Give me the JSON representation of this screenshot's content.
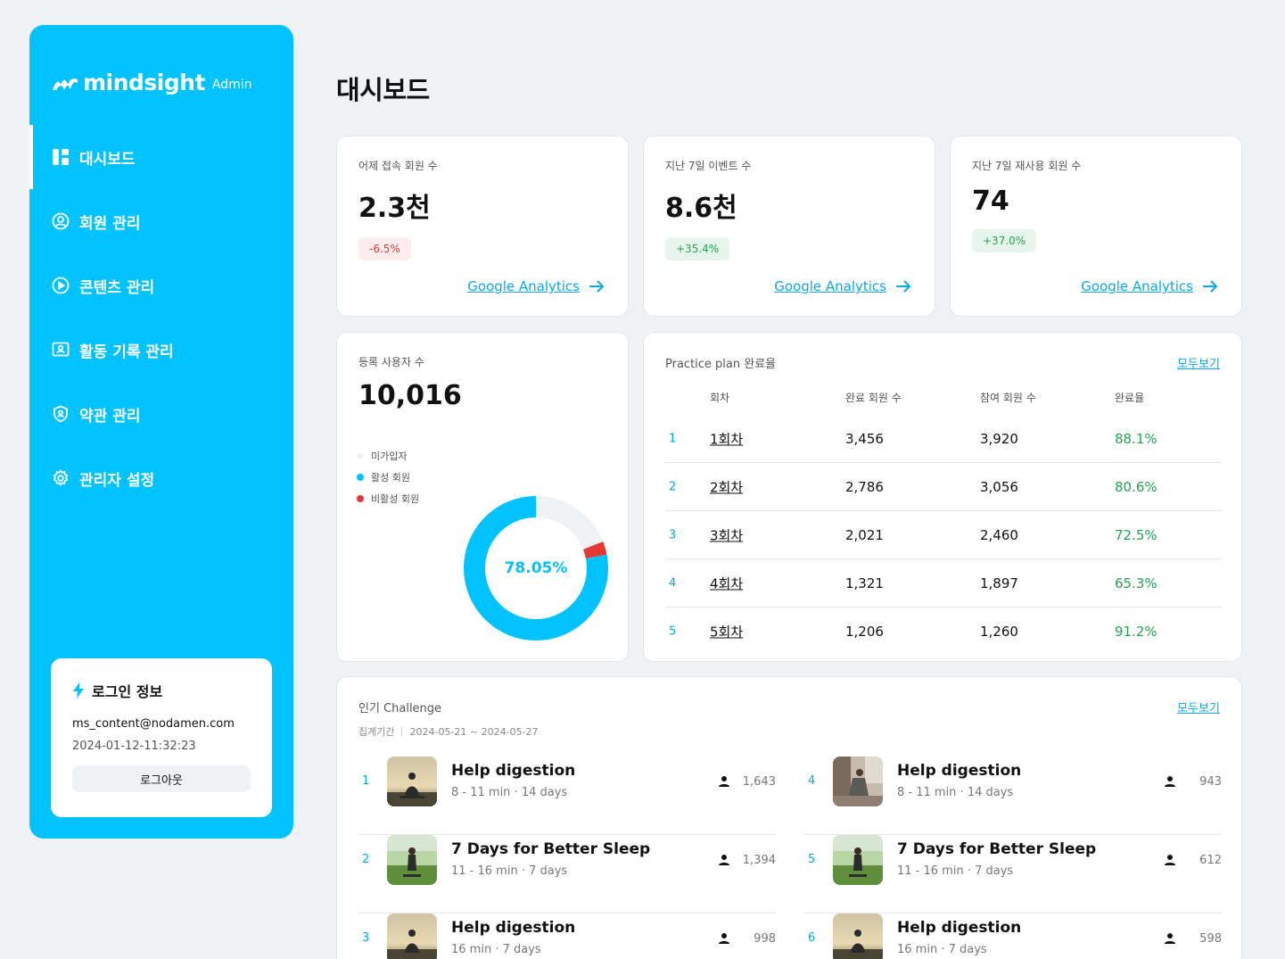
{
  "brand": {
    "name": "mindsight",
    "sub": "Admin"
  },
  "page_title": "대시보드",
  "nav": [
    {
      "label": "대시보드",
      "icon": "dashboard-icon",
      "active": true
    },
    {
      "label": "회원 관리",
      "icon": "user-circle-icon"
    },
    {
      "label": "콘텐츠 관리",
      "icon": "play-circle-icon"
    },
    {
      "label": "활동 기록 관리",
      "icon": "id-card-icon"
    },
    {
      "label": "약관 관리",
      "icon": "shield-user-icon"
    },
    {
      "label": "관리자 설정",
      "icon": "gear-icon"
    }
  ],
  "login": {
    "title": "로그인 정보",
    "email": "ms_content@nodamen.com",
    "time": "2024-01-12-11:32:23",
    "logout": "로그아웃"
  },
  "metrics": [
    {
      "label": "어제 접속 회원 수",
      "value": "2.3천",
      "change": "-6.5%",
      "trend": "neg",
      "link": "Google Analytics"
    },
    {
      "label": "지난 7일 이벤트 수",
      "value": "8.6천",
      "change": "+35.4%",
      "trend": "pos",
      "link": "Google Analytics"
    },
    {
      "label": "지난 7일 재사용 회원 수",
      "value": "74",
      "change": "+37.0%",
      "trend": "pos",
      "link": "Google Analytics"
    }
  ],
  "registered": {
    "label": "등록 사용자 수",
    "value": "10,016",
    "legend": [
      {
        "name": "미가입자",
        "color": "#EEF2F5"
      },
      {
        "name": "활성 회원",
        "color": "#00C2FF"
      },
      {
        "name": "비활성 회원",
        "color": "#E53935"
      }
    ],
    "center_label": "78.05%",
    "shares": {
      "active": 0.7805,
      "inactive": 0.03,
      "unregistered": 0.1895
    }
  },
  "plan": {
    "title": "Practice plan 완료율",
    "see_all": "모두보기",
    "headers": [
      "회차",
      "완료 회원 수",
      "참여 회원 수",
      "완료율"
    ],
    "rows": [
      {
        "idx": "1",
        "name": "1회차",
        "done": "3,456",
        "join": "3,920",
        "rate": "88.1%"
      },
      {
        "idx": "2",
        "name": "2회차",
        "done": "2,786",
        "join": "3,056",
        "rate": "80.6%"
      },
      {
        "idx": "3",
        "name": "3회차",
        "done": "2,021",
        "join": "2,460",
        "rate": "72.5%"
      },
      {
        "idx": "4",
        "name": "4회차",
        "done": "1,321",
        "join": "1,897",
        "rate": "65.3%"
      },
      {
        "idx": "5",
        "name": "5회차",
        "done": "1,206",
        "join": "1,260",
        "rate": "91.2%"
      }
    ]
  },
  "challenge": {
    "title": "인기 Challenge",
    "period_label": "집계기간",
    "period": "2024-05-21 ~ 2024-05-27",
    "see_all": "모두보기",
    "items": [
      {
        "rank": "1",
        "title": "Help digestion",
        "meta": "8 - 11 min · 14 days",
        "count": "1,643",
        "thumb": "sunset"
      },
      {
        "rank": "2",
        "title": "7 Days for Better Sleep",
        "meta": "11 - 16 min · 7 days",
        "count": "1,394",
        "thumb": "field"
      },
      {
        "rank": "3",
        "title": "Help digestion",
        "meta": "16 min · 7 days",
        "count": "998",
        "thumb": "sunset"
      },
      {
        "rank": "4",
        "title": "Help digestion",
        "meta": "8 - 11 min · 14 days",
        "count": "943",
        "thumb": "room"
      },
      {
        "rank": "5",
        "title": "7 Days for Better Sleep",
        "meta": "11 - 16 min · 7 days",
        "count": "612",
        "thumb": "field"
      },
      {
        "rank": "6",
        "title": "Help digestion",
        "meta": "16 min · 7 days",
        "count": "598",
        "thumb": "sunset"
      }
    ]
  }
}
